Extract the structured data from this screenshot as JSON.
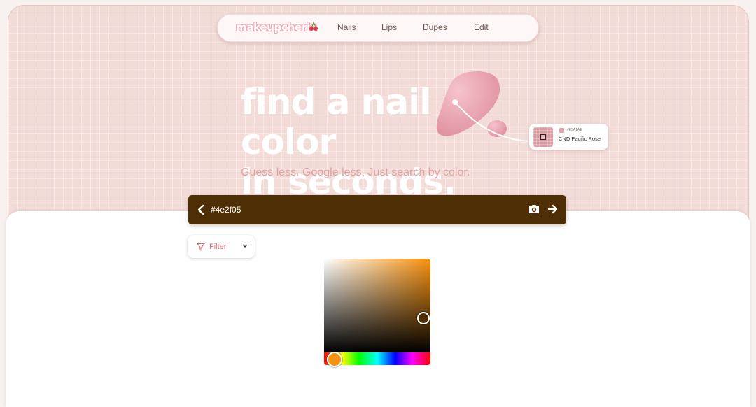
{
  "nav": {
    "logo": "makeupcherie",
    "links": [
      "Nails",
      "Lips",
      "Dupes",
      "Edit"
    ]
  },
  "hero": {
    "headline_line1": "find a nail color",
    "headline_line2": "in seconds.",
    "subline": "Guess less. Google less. Just search by color."
  },
  "swatch_card": {
    "hex": "#E5A1AE",
    "name": "CND Pacific Rose"
  },
  "search": {
    "value": "#4e2f05"
  },
  "filter": {
    "label": "Filter"
  },
  "colors": {
    "accent": "#4e2f05",
    "hero_bg": "#f3dcd8",
    "picker_hue": "#f7910e",
    "blob_pink": "#e59aa8",
    "filter_text": "#d66a70"
  },
  "icons": [
    "cherry-icon",
    "back-arrow-icon",
    "camera-icon",
    "arrow-right-icon",
    "filter-icon",
    "chevron-down-icon"
  ]
}
